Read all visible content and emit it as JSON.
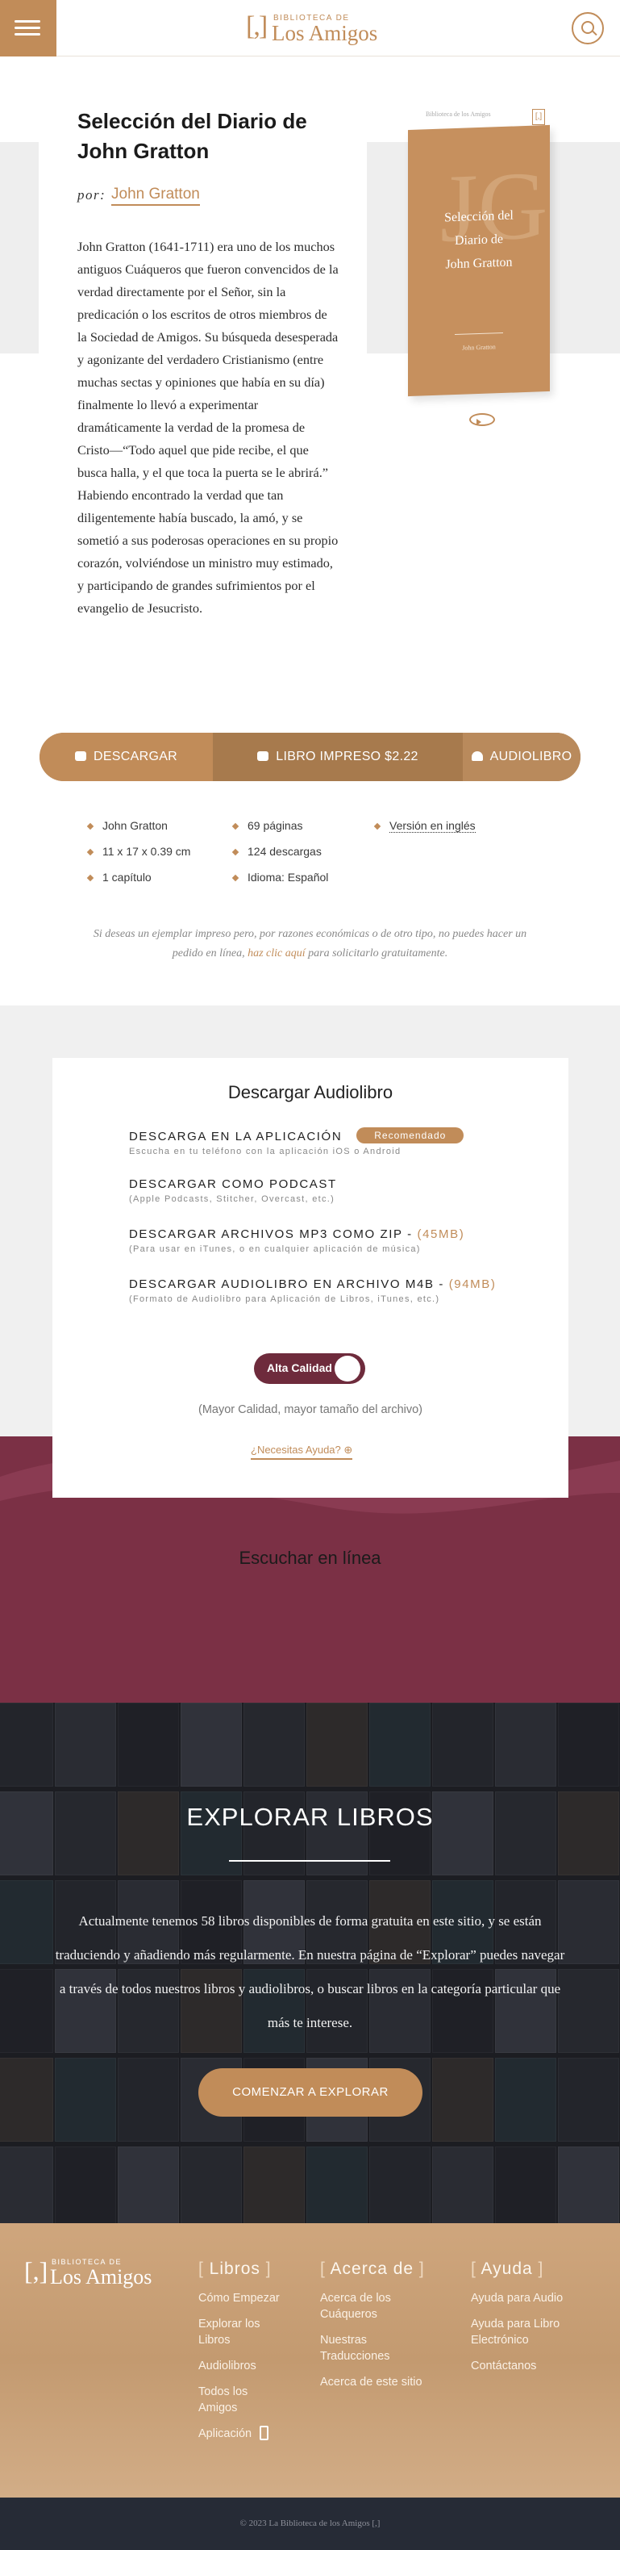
{
  "header": {
    "logo_top": "BIBLIOTECA DE",
    "logo_name": "Los Amigos",
    "logo_mark": "[,]",
    "menu_icon": "hamburger-icon",
    "search_icon": "search-icon"
  },
  "book": {
    "title": "Selección del Diario de John Gratton",
    "by_label": "por:",
    "author": "John Gratton",
    "description": "John Gratton (1641-1711) era uno de los muchos antiguos Cuáqueros que fueron convencidos de la verdad directamente por el Señor, sin la predicación o los escritos de otros miembros de la Sociedad de Amigos. Su búsqueda desesperada y agonizante del verdadero Cristianismo (entre muchas sectas y opiniones que había en su día) finalmente lo llevó a experimentar dramáticamente la verdad de la promesa de Cristo—“Todo aquel que pide recibe, el que busca halla, y el que toca la puerta se le abrirá.” Habiendo encontrado la verdad que tan diligentemente había buscado, la amó, y se sometió a sus poderosas operaciones en su propio corazón, volviéndose un ministro muy estimado, y participando de grandes sufrimientos por el evangelio de Jesucristo.",
    "cover": {
      "series": "Biblioteca de los Amigos",
      "mark": "[,]",
      "initials": "JG",
      "title_l1": "Selección del",
      "title_l2": "Diario de",
      "title_l3": "John Gratton",
      "author": "John Gratton"
    }
  },
  "actions": {
    "download": "DESCARGAR",
    "print": "LIBRO IMPRESO $2.22",
    "audio": "AUDIOLIBRO"
  },
  "meta": {
    "author": "John Gratton",
    "size": "11 x 17 x 0.39 cm",
    "chapters": "1 capítulo",
    "pages": "69 páginas",
    "downloads": "124 descargas",
    "language": "Idioma: Español",
    "english": "Versión en inglés"
  },
  "note": {
    "before": "Si deseas un ejemplar impreso pero, por razones económicas o de otro tipo, no puedes hacer un pedido en línea,",
    "link": "haz clic aquí",
    "after": "para solicitarlo gratuitamente."
  },
  "audio": {
    "title": "Descargar Audiolibro",
    "options": [
      {
        "label": "DESCARGA EN LA APLICACIÓN",
        "badge": "Recomendado",
        "sub": "Escucha en tu teléfono con la aplicación iOS o Android"
      },
      {
        "label": "DESCARGAR COMO PODCAST",
        "sub": "(Apple Podcasts, Stitcher, Overcast, etc.)"
      },
      {
        "label": "DESCARGAR ARCHIVOS MP3 COMO ZIP - ",
        "size": "(45MB)",
        "sub": "(Para usar en iTunes, o en cualquier aplicación de música)"
      },
      {
        "label": "DESCARGAR AUDIOLIBRO EN ARCHIVO M4B - ",
        "size": "(94MB)",
        "sub": "(Formato de Audiolibro para Aplicación de Libros, iTunes, etc.)"
      }
    ],
    "quality": "Alta Calidad",
    "quality_on": true,
    "quality_note": "(Mayor Calidad, mayor tamaño del archivo)",
    "help": "¿Necesitas Ayuda?",
    "listen": "Escuchar en línea"
  },
  "explore": {
    "title": "EXPLORAR LIBROS",
    "text": "Actualmente tenemos 58 libros disponibles de forma gratuita en este sitio, y se están traduciendo y añadiendo más regularmente. En nuestra página de “Explorar” puedes navegar a través de todos nuestros libros y audiolibros, o buscar libros en la categoría particular que más te interese.",
    "button": "COMENZAR A EXPLORAR"
  },
  "footer": {
    "logo_top": "BIBLIOTECA DE",
    "logo_name": "Los Amigos",
    "col1": {
      "heading": "Libros",
      "items": [
        "Cómo Empezar",
        "Explorar los Libros",
        "Audiolibros",
        "Todos los Amigos",
        "Aplicación"
      ]
    },
    "col2": {
      "heading": "Acerca de",
      "items": [
        "Acerca de los Cuáqueros",
        "Nuestras Traducciones",
        "Acerca de este sitio"
      ]
    },
    "col3": {
      "heading": "Ayuda",
      "items": [
        "Ayuda para Audio",
        "Ayuda para Libro Electrónico",
        "Contáctanos"
      ]
    },
    "copyright": "© 2023 La Biblioteca de los Amigos [,]"
  },
  "colors": {
    "accent": "#c18c59",
    "maroon": "#7b3045",
    "dark": "#1c1d22",
    "footer_bottom": "#262b36"
  }
}
